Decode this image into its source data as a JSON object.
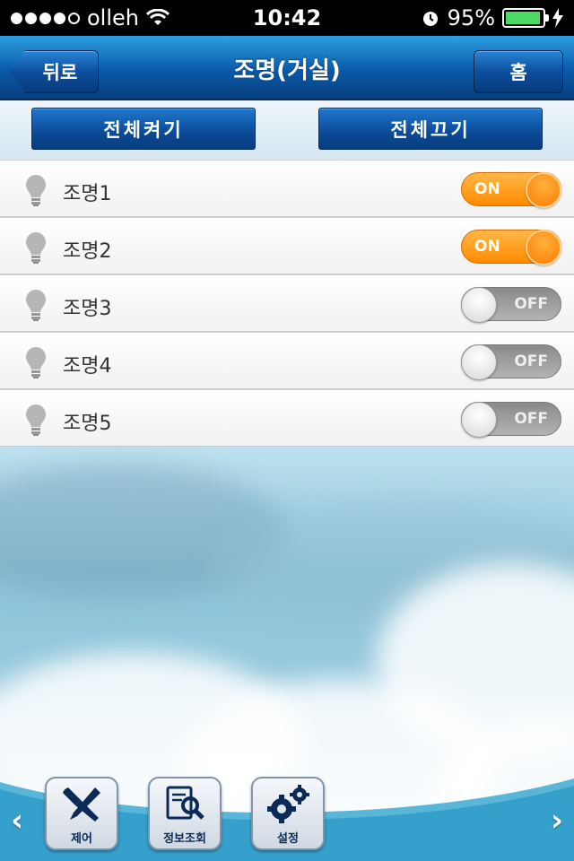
{
  "status_bar": {
    "carrier": "olleh",
    "time": "10:42",
    "battery": "95%",
    "battery_level": 0.95,
    "signal_dots_filled": 4,
    "signal_dots_total": 5
  },
  "nav": {
    "back_label": "뒤로",
    "title": "조명(거실)",
    "home_label": "홈"
  },
  "all_controls": {
    "all_on_label": "전체켜기",
    "all_off_label": "전체끄기"
  },
  "lights": [
    {
      "label": "조명1",
      "state": "ON",
      "on": true
    },
    {
      "label": "조명2",
      "state": "ON",
      "on": true
    },
    {
      "label": "조명3",
      "state": "OFF",
      "on": false
    },
    {
      "label": "조명4",
      "state": "OFF",
      "on": false
    },
    {
      "label": "조명5",
      "state": "OFF",
      "on": false
    }
  ],
  "toolbar": {
    "left_arrow": "‹",
    "right_arrow": "›",
    "items": [
      {
        "label": "제어",
        "icon": "tools-icon"
      },
      {
        "label": "정보조회",
        "icon": "document-search-icon"
      },
      {
        "label": "설정",
        "icon": "gears-icon"
      }
    ]
  },
  "colors": {
    "nav_blue": "#0a5aa8",
    "toggle_on": "#ff8a00",
    "toggle_off": "#9a9a9a",
    "battery_green": "#4cd964"
  }
}
